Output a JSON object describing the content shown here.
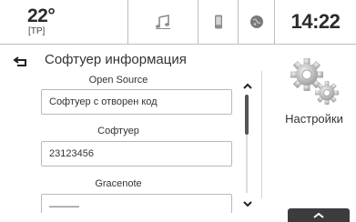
{
  "status_bar": {
    "temperature": "22°",
    "traffic_program": "[TP]",
    "clock": "14:22",
    "tabs": [
      {
        "icon": "music-note-icon"
      },
      {
        "icon": "phone-icon"
      },
      {
        "icon": "globe-icon"
      }
    ]
  },
  "header": {
    "back_icon": "back-arrow-icon",
    "title": "Софтуер информация"
  },
  "list": {
    "sections": [
      {
        "label": "Open Source",
        "value": "Софтуер с отворен код"
      },
      {
        "label": "Софтуер",
        "value": "23123456"
      },
      {
        "label": "Gracenote",
        "value": "———"
      }
    ]
  },
  "right_panel": {
    "settings_label": "Настройки",
    "settings_icon": "gears-icon",
    "up_icon": "chevron-up-icon"
  },
  "colors": {
    "text": "#2a2a2a",
    "border": "#b9b9b9",
    "dark_button": "#3c3c3c",
    "scroll_thumb": "#555555"
  }
}
